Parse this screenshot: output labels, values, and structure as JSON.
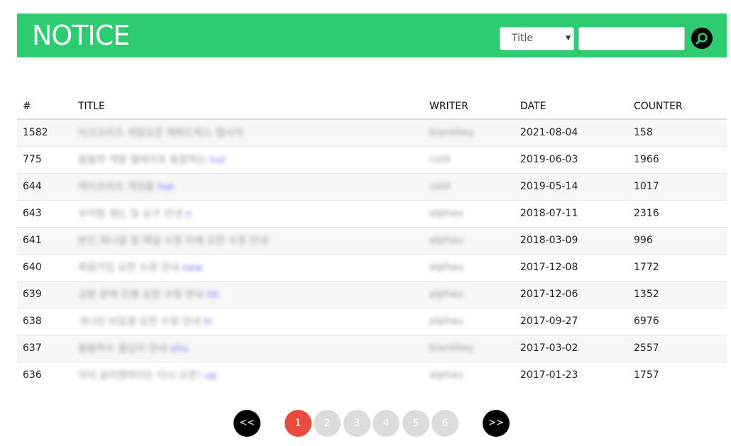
{
  "header": {
    "title": "NOTICE",
    "search_field": "Title",
    "search_value": ""
  },
  "table": {
    "columns": [
      "#",
      "TITLE",
      "WRITER",
      "DATE",
      "COUNTER"
    ],
    "rows": [
      {
        "num": "1582",
        "title": "아크코리즈 게임오픈 에피드릭스 앱시의",
        "tail": "",
        "writer": "blankkey",
        "date": "2021-08-04",
        "counter": "158"
      },
      {
        "num": "775",
        "title": "봄봄하 개발 엘레이포 동참하는",
        "tail": "hot",
        "writer": "cold",
        "date": "2019-06-03",
        "counter": "1966"
      },
      {
        "num": "644",
        "title": "에이코리즈 게임즐",
        "tail": "hot",
        "writer": "cold",
        "date": "2019-05-14",
        "counter": "1017"
      },
      {
        "num": "643",
        "title": "우이링 재는 및 요구 안내",
        "tail": "n",
        "writer": "alphau",
        "date": "2018-07-11",
        "counter": "2316"
      },
      {
        "num": "641",
        "title": "본인 재나결 및 채널 수정 자체 요한 수정 안내",
        "tail": "",
        "writer": "alphau",
        "date": "2018-03-09",
        "counter": "996"
      },
      {
        "num": "640",
        "title": "회원가입 요한 수정 안내",
        "tail": "new",
        "writer": "alphau",
        "date": "2017-12-08",
        "counter": "1772"
      },
      {
        "num": "639",
        "title": "교환 문제 진행 요한 수정 안내",
        "tail": "hh",
        "writer": "alphau",
        "date": "2017-12-06",
        "counter": "1352"
      },
      {
        "num": "638",
        "title": "개나린 비밀결 요한 수정 안내",
        "tail": "hi",
        "writer": "alphau",
        "date": "2017-09-27",
        "counter": "6976"
      },
      {
        "num": "637",
        "title": "봄봄하수 결심이 안내",
        "tail": "ohu",
        "writer": "blankkey",
        "date": "2017-03-02",
        "counter": "2557"
      },
      {
        "num": "636",
        "title": "아이 글리젠하이는 다시 오픈!",
        "tail": "up",
        "writer": "alphau",
        "date": "2017-01-23",
        "counter": "1757"
      }
    ]
  },
  "pager": {
    "prev": "<<",
    "next": ">>",
    "pages": [
      "1",
      "2",
      "3",
      "4",
      "5",
      "6"
    ],
    "active": "1"
  },
  "colors": {
    "header": "#2ecc71",
    "active_page": "#e74c3c",
    "inactive_page": "#dcdcdc"
  }
}
